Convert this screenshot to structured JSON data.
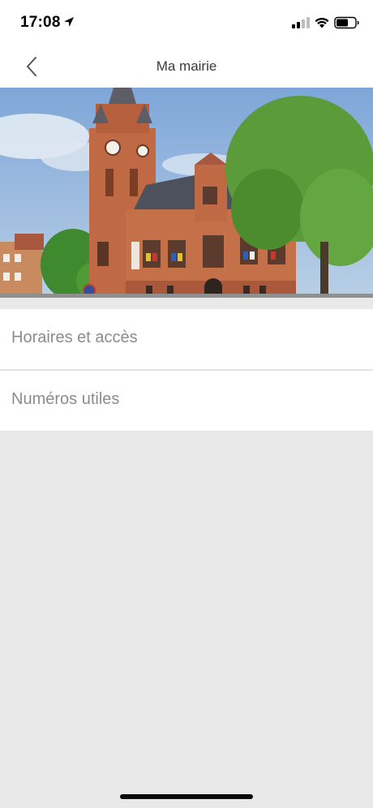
{
  "status_bar": {
    "time": "17:08",
    "icons": [
      "location-arrow-icon",
      "cellular-signal-icon",
      "wifi-icon",
      "battery-icon"
    ]
  },
  "nav": {
    "title": "Ma mairie",
    "back_icon": "chevron-left-icon"
  },
  "hero": {
    "image": "town-hall-photo"
  },
  "menu": {
    "items": [
      {
        "label": "Horaires et accès"
      },
      {
        "label": "Numéros utiles"
      }
    ]
  },
  "colors": {
    "background": "#e9e9e9",
    "surface": "#ffffff",
    "item_text": "#8c8c8c",
    "title_text": "#3a3a3a"
  }
}
